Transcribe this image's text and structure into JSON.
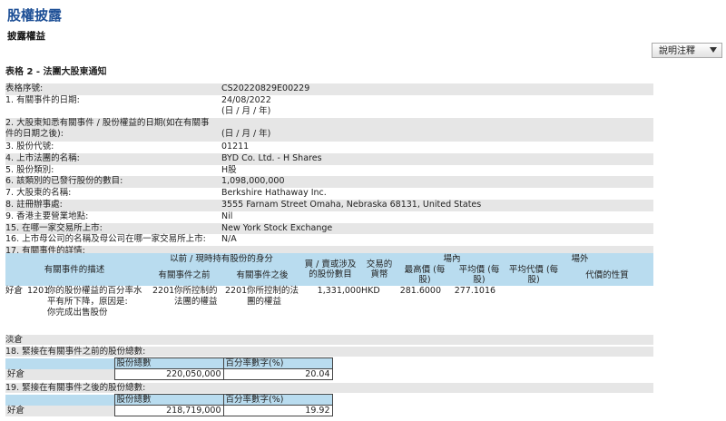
{
  "header": {
    "title": "股權披露",
    "subtitle": "披露權益",
    "notes_button": "說明注釋",
    "form_title": "表格 2 - 法團大股東通知"
  },
  "fields": [
    {
      "label": "表格序號:",
      "value": "CS20220829E00229",
      "lines": 1
    },
    {
      "label": "1. 有關事件的日期:",
      "value": "24/08/2022\n(日 / 月 / 年)",
      "lines": 2
    },
    {
      "label": "2. 大股東知悉有關事件 / 股份權益的日期(如在有關事件的日期之後):",
      "value": "\n(日 / 月 / 年)",
      "lines": 2
    },
    {
      "label": "3. 股份代號:",
      "value": "01211",
      "lines": 1
    },
    {
      "label": "4. 上市法團的名稱:",
      "value": "BYD Co. Ltd. - H Shares",
      "lines": 1
    },
    {
      "label": "5. 股份類別:",
      "value": "H股",
      "lines": 1
    },
    {
      "label": "6. 該類別的已發行股份的數目:",
      "value": "1,098,000,000",
      "lines": 1
    },
    {
      "label": "7. 大股東的名稱:",
      "value": "Berkshire Hathaway Inc.",
      "lines": 1
    },
    {
      "label": "8. 註冊辦事處:",
      "value": "3555 Farnam Street Omaha, Nebraska 68131, United States",
      "lines": 1
    },
    {
      "label": "9. 香港主要營業地點:",
      "value": "Nil",
      "lines": 1
    },
    {
      "label": "15. 在哪一家交易所上市:",
      "value": "New York Stock Exchange",
      "lines": 1
    },
    {
      "label": "16. 上市母公司的名稱及母公司在哪一家交易所上市:",
      "value": "N/A",
      "lines": 1
    },
    {
      "label": "17. 有關事件的詳情:",
      "value": "",
      "lines": 1
    }
  ],
  "details": {
    "headers": {
      "description": "有關事件的描述",
      "capacity": "以前 / 現時持有股份的身分",
      "before": "有關事件之前",
      "after": "有關事件之後",
      "shares": "買 / 賣或涉及的股份數目",
      "currency": "交易的貨幣",
      "on_exchange": "場內",
      "highest": "最高價 (每股)",
      "average": "平均價 (每股)",
      "off_exchange": "場外",
      "avg_off": "平均代價 (每股)",
      "consideration": "代價的性質"
    },
    "row": {
      "position": "好倉",
      "event_code": "1201",
      "event_desc": "你的股份權益的百分率水平有所下降，原因是:\n你完成出售股份",
      "before_code": "2201",
      "before_desc": "你所控制的法團的權益",
      "after_code": "2201",
      "after_desc": "你所控制的法團的權益",
      "shares": "1,331,000",
      "currency": "HKD",
      "highest": "281.6000",
      "average": "277.1016"
    }
  },
  "misc": {
    "label": "淡倉"
  },
  "before_total": {
    "title": "18. 緊接在有關事件之前的股份總數:",
    "col_shares": "股份總數",
    "col_pct": "百分率數字(%)",
    "row_label": "好倉",
    "shares": "220,050,000",
    "pct": "20.04"
  },
  "after_total": {
    "title": "19. 緊接在有關事件之後的股份總數:",
    "col_shares": "股份總數",
    "col_pct": "百分率數字(%)",
    "row_label": "好倉",
    "shares": "218,719,000",
    "pct": "19.92"
  }
}
